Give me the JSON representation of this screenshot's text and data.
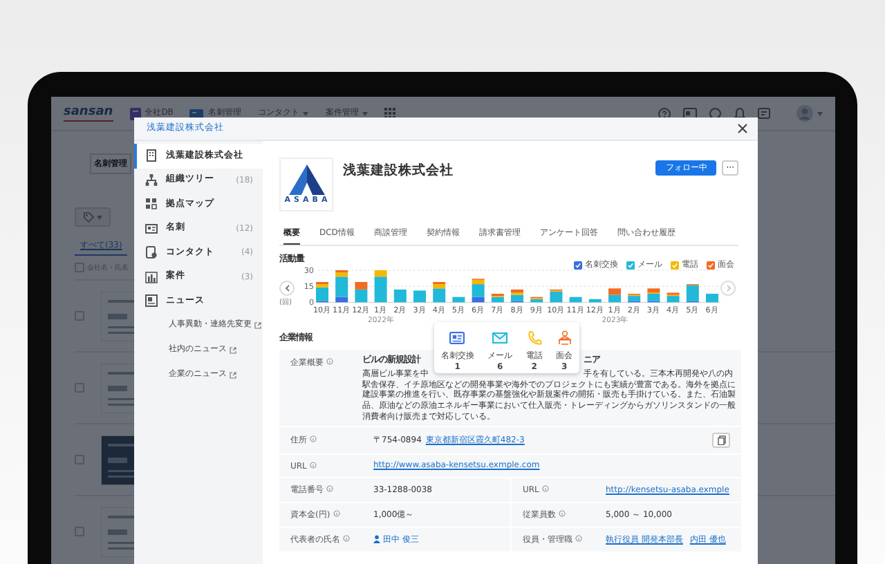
{
  "app": {
    "logo": "sansan",
    "nav": [
      {
        "kind": "db",
        "label": "全社DB"
      },
      {
        "kind": "cards",
        "label": "名刺管理"
      },
      {
        "kind": "menu",
        "label": "コンタクト"
      },
      {
        "kind": "menu",
        "label": "案件管理"
      }
    ],
    "page_button": "名刺管理",
    "select_all_checked": false,
    "filter_tab": "すべて(33)",
    "list_header": "会社名・氏名",
    "cards": [
      {
        "kind": "light",
        "checked": false
      },
      {
        "kind": "light",
        "checked": false
      },
      {
        "kind": "dark",
        "checked": false
      },
      {
        "kind": "light",
        "checked": false
      }
    ]
  },
  "modal": {
    "breadcrumb": "浅葉建設株式会社",
    "sidebar": [
      {
        "kind": "building",
        "label": "浅葉建設株式会社",
        "selected": true
      },
      {
        "kind": "tree",
        "label": "組織ツリー",
        "count": "(18)",
        "selected": false
      },
      {
        "kind": "map",
        "label": "拠点マップ",
        "selected": false
      },
      {
        "kind": "card",
        "label": "名刺",
        "count": "(12)",
        "selected": false
      },
      {
        "kind": "contact",
        "label": "コンタクト",
        "count": "(4)",
        "selected": false
      },
      {
        "kind": "case",
        "label": "案件",
        "count": "(3)",
        "selected": false
      },
      {
        "kind": "news",
        "label": "ニュース",
        "selected": false,
        "children": [
          {
            "label": "人事異動・連絡先変更",
            "selected": false
          },
          {
            "label": "社内のニュース",
            "selected": false
          },
          {
            "label": "企業のニュース",
            "selected": false
          }
        ]
      }
    ],
    "company": {
      "logo_text": "ASABA",
      "name": "浅葉建設株式会社",
      "follow_button": "フォロー中",
      "more_button": "···"
    },
    "tabs": [
      {
        "label": "概要",
        "selected": true
      },
      {
        "label": "DCD情報",
        "selected": false
      },
      {
        "label": "商談管理",
        "selected": false
      },
      {
        "label": "契約情報",
        "selected": false
      },
      {
        "label": "請求書管理",
        "selected": false
      },
      {
        "label": "アンケート回答",
        "selected": false
      },
      {
        "label": "問い合わせ履歴",
        "selected": false
      }
    ],
    "activity": {
      "title": "活動量",
      "legend": [
        {
          "checked": true
        },
        {
          "checked": true
        },
        {
          "checked": true
        },
        {
          "checked": true
        }
      ],
      "chart_data": {
        "type": "bar",
        "stacked": true,
        "ylabel": "(回)",
        "categories": [
          "10月",
          "11月",
          "12月",
          "1月",
          "2月",
          "3月",
          "4月",
          "5月",
          "6月",
          "7月",
          "8月",
          "9月",
          "10月",
          "11月",
          "12月",
          "1月",
          "2月",
          "3月",
          "4月",
          "5月",
          "6月"
        ],
        "series": [
          {
            "name": "名刺交換",
            "color": "#3a6fe0",
            "values": [
              1,
              5,
              0,
              0,
              0,
              0,
              0,
              0,
              5,
              0,
              1,
              0,
              0,
              0,
              0,
              0,
              1,
              1,
              0,
              1,
              0
            ]
          },
          {
            "name": "メール",
            "color": "#22b8d8",
            "values": [
              13,
              19,
              12,
              24,
              12,
              11,
              13,
              5,
              12,
              5,
              6,
              3,
              10,
              5,
              3,
              7,
              5,
              7,
              6,
              15,
              8
            ]
          },
          {
            "name": "電話",
            "color": "#f5b800",
            "values": [
              3,
              4,
              0,
              6,
              0,
              0,
              4,
              0,
              4,
              1,
              2,
              1,
              1,
              0,
              0,
              0,
              1,
              1,
              1,
              0,
              0
            ]
          },
          {
            "name": "面会",
            "color": "#f26b21",
            "values": [
              2,
              2,
              7,
              0,
              0,
              0,
              2,
              0,
              1,
              2,
              3,
              1,
              1,
              0,
              0,
              6,
              1,
              4,
              2,
              1,
              0
            ]
          }
        ],
        "ylim": [
          0,
          30
        ],
        "yticks": [
          0,
          15,
          30
        ],
        "annotations": [
          {
            "x": "1月",
            "y": 0,
            "text": "2022年"
          },
          "2023年"
        ]
      },
      "tooltip": [
        {
          "kind": "card",
          "label": "名刺交換",
          "count": "1"
        },
        {
          "kind": "mail",
          "label": "メール",
          "count": "6"
        },
        {
          "kind": "phone",
          "label": "電話",
          "count": "2"
        },
        {
          "kind": "meeting",
          "label": "面会",
          "count": "3"
        }
      ]
    },
    "info": {
      "heading": "企業情報",
      "rows": [
        {
          "kind": "overview",
          "label": "企業概要",
          "heading_start": "ビルの新規設計",
          "heading_end": "ニア",
          "text_start": "高層ビル事業を中",
          "text_end": "手を有している。三本木再開発や八の内",
          "text_rest": "駅舎保存、イチ原地区などの開発事業や海外でのプロジェクトにも実績が豊富である。海外を拠点に建設事業の推進を行い、既存事業の基盤強化や新規案件の開拓・販売も手掛けている。また、石油製品、原油などの原油エネルギー事業において仕入販売・トレーディングからガソリンスタンドの一般消費者向け販売まで対応している。"
        },
        {
          "kind": "address",
          "label": "住所",
          "postal": "〒754-0894",
          "address": "東京都新宿区霞久町482-3"
        },
        {
          "kind": "single",
          "label": "URL",
          "value": "http://www.asaba-kensetsu.exmple.com",
          "link": true
        },
        {
          "kind": "pair",
          "cells": [
            {
              "label": "電話番号",
              "value": "33-1288-0038",
              "link": false
            },
            {
              "label": "URL",
              "value": "http://kensetsu-asaba.exmple",
              "link": true
            }
          ]
        },
        {
          "kind": "pair",
          "cells": [
            {
              "label": "資本金(円)",
              "value": "1,000億～",
              "link": false
            },
            {
              "label": "従業員数",
              "value": "5,000 ～ 10,000",
              "link": false
            }
          ]
        },
        {
          "kind": "pair",
          "cells": [
            {
              "label": "代表者の氏名",
              "value": "田中 俊三",
              "link": true,
              "person": true
            },
            {
              "label": "役員・管理職",
              "value": "執行役員 開発本部長",
              "extra": "内田 優也",
              "link": true
            }
          ]
        }
      ]
    }
  }
}
